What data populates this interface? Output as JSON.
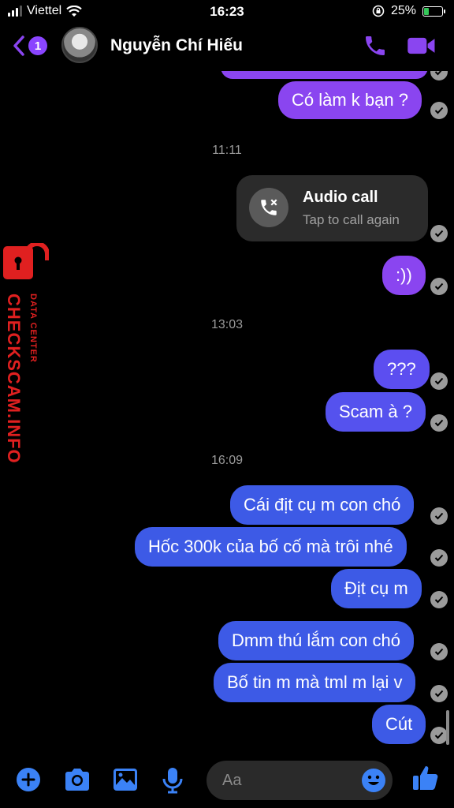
{
  "status_bar": {
    "carrier": "Viettel",
    "time": "16:23",
    "battery": "25%"
  },
  "header": {
    "back_badge": "1",
    "contact_name": "Nguyễn Chí Hiếu"
  },
  "messages": [
    {
      "text": "Có làm k bạn ?"
    },
    {
      "text": ":))"
    },
    {
      "text": "???"
    },
    {
      "text": "Scam à ?"
    },
    {
      "text": "Cái địt cụ m con chó"
    },
    {
      "text": "Hốc 300k của bố cố mà trôi nhé"
    },
    {
      "text": "Địt cụ m"
    },
    {
      "text": "Dmm thú lắm con chó"
    },
    {
      "text": "Bố tin m mà tml m lại v"
    },
    {
      "text": "Cút"
    }
  ],
  "timestamps": [
    "11:11",
    "13:03",
    "16:09"
  ],
  "call": {
    "title": "Audio call",
    "subtitle": "Tap to call again"
  },
  "watermark": {
    "main": "CHECKSCAM.INFO",
    "sub": "DATA CENTER"
  },
  "composer": {
    "placeholder": "Aa"
  },
  "icons": [
    "back-chevron-icon",
    "phone-icon",
    "video-icon",
    "missed-call-icon",
    "seen-check-icon",
    "plus-icon",
    "camera-icon",
    "image-icon",
    "microphone-icon",
    "emoji-icon",
    "thumbs-up-icon",
    "lock-icon"
  ],
  "colors": {
    "accent_purple": "#8a45f0",
    "bubble_blue": "#3d5ae6",
    "icon_blue": "#3b82f6",
    "watermark_red": "#e02020"
  }
}
